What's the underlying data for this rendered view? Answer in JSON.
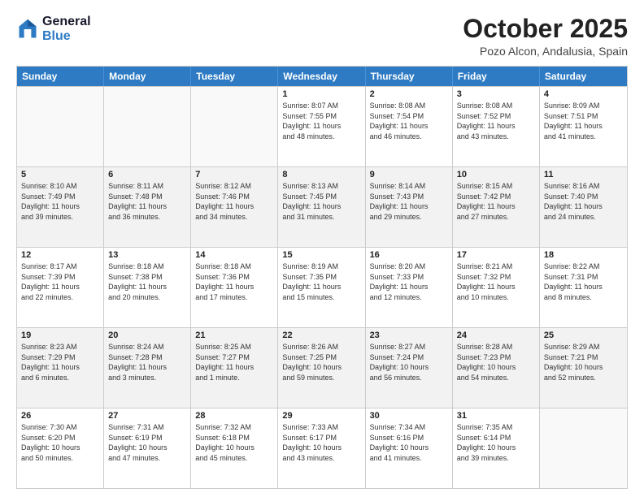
{
  "logo": {
    "line1": "General",
    "line2": "Blue"
  },
  "title": "October 2025",
  "location": "Pozo Alcon, Andalusia, Spain",
  "days_of_week": [
    "Sunday",
    "Monday",
    "Tuesday",
    "Wednesday",
    "Thursday",
    "Friday",
    "Saturday"
  ],
  "weeks": [
    [
      {
        "day": "",
        "info": ""
      },
      {
        "day": "",
        "info": ""
      },
      {
        "day": "",
        "info": ""
      },
      {
        "day": "1",
        "info": "Sunrise: 8:07 AM\nSunset: 7:55 PM\nDaylight: 11 hours\nand 48 minutes."
      },
      {
        "day": "2",
        "info": "Sunrise: 8:08 AM\nSunset: 7:54 PM\nDaylight: 11 hours\nand 46 minutes."
      },
      {
        "day": "3",
        "info": "Sunrise: 8:08 AM\nSunset: 7:52 PM\nDaylight: 11 hours\nand 43 minutes."
      },
      {
        "day": "4",
        "info": "Sunrise: 8:09 AM\nSunset: 7:51 PM\nDaylight: 11 hours\nand 41 minutes."
      }
    ],
    [
      {
        "day": "5",
        "info": "Sunrise: 8:10 AM\nSunset: 7:49 PM\nDaylight: 11 hours\nand 39 minutes."
      },
      {
        "day": "6",
        "info": "Sunrise: 8:11 AM\nSunset: 7:48 PM\nDaylight: 11 hours\nand 36 minutes."
      },
      {
        "day": "7",
        "info": "Sunrise: 8:12 AM\nSunset: 7:46 PM\nDaylight: 11 hours\nand 34 minutes."
      },
      {
        "day": "8",
        "info": "Sunrise: 8:13 AM\nSunset: 7:45 PM\nDaylight: 11 hours\nand 31 minutes."
      },
      {
        "day": "9",
        "info": "Sunrise: 8:14 AM\nSunset: 7:43 PM\nDaylight: 11 hours\nand 29 minutes."
      },
      {
        "day": "10",
        "info": "Sunrise: 8:15 AM\nSunset: 7:42 PM\nDaylight: 11 hours\nand 27 minutes."
      },
      {
        "day": "11",
        "info": "Sunrise: 8:16 AM\nSunset: 7:40 PM\nDaylight: 11 hours\nand 24 minutes."
      }
    ],
    [
      {
        "day": "12",
        "info": "Sunrise: 8:17 AM\nSunset: 7:39 PM\nDaylight: 11 hours\nand 22 minutes."
      },
      {
        "day": "13",
        "info": "Sunrise: 8:18 AM\nSunset: 7:38 PM\nDaylight: 11 hours\nand 20 minutes."
      },
      {
        "day": "14",
        "info": "Sunrise: 8:18 AM\nSunset: 7:36 PM\nDaylight: 11 hours\nand 17 minutes."
      },
      {
        "day": "15",
        "info": "Sunrise: 8:19 AM\nSunset: 7:35 PM\nDaylight: 11 hours\nand 15 minutes."
      },
      {
        "day": "16",
        "info": "Sunrise: 8:20 AM\nSunset: 7:33 PM\nDaylight: 11 hours\nand 12 minutes."
      },
      {
        "day": "17",
        "info": "Sunrise: 8:21 AM\nSunset: 7:32 PM\nDaylight: 11 hours\nand 10 minutes."
      },
      {
        "day": "18",
        "info": "Sunrise: 8:22 AM\nSunset: 7:31 PM\nDaylight: 11 hours\nand 8 minutes."
      }
    ],
    [
      {
        "day": "19",
        "info": "Sunrise: 8:23 AM\nSunset: 7:29 PM\nDaylight: 11 hours\nand 6 minutes."
      },
      {
        "day": "20",
        "info": "Sunrise: 8:24 AM\nSunset: 7:28 PM\nDaylight: 11 hours\nand 3 minutes."
      },
      {
        "day": "21",
        "info": "Sunrise: 8:25 AM\nSunset: 7:27 PM\nDaylight: 11 hours\nand 1 minute."
      },
      {
        "day": "22",
        "info": "Sunrise: 8:26 AM\nSunset: 7:25 PM\nDaylight: 10 hours\nand 59 minutes."
      },
      {
        "day": "23",
        "info": "Sunrise: 8:27 AM\nSunset: 7:24 PM\nDaylight: 10 hours\nand 56 minutes."
      },
      {
        "day": "24",
        "info": "Sunrise: 8:28 AM\nSunset: 7:23 PM\nDaylight: 10 hours\nand 54 minutes."
      },
      {
        "day": "25",
        "info": "Sunrise: 8:29 AM\nSunset: 7:21 PM\nDaylight: 10 hours\nand 52 minutes."
      }
    ],
    [
      {
        "day": "26",
        "info": "Sunrise: 7:30 AM\nSunset: 6:20 PM\nDaylight: 10 hours\nand 50 minutes."
      },
      {
        "day": "27",
        "info": "Sunrise: 7:31 AM\nSunset: 6:19 PM\nDaylight: 10 hours\nand 47 minutes."
      },
      {
        "day": "28",
        "info": "Sunrise: 7:32 AM\nSunset: 6:18 PM\nDaylight: 10 hours\nand 45 minutes."
      },
      {
        "day": "29",
        "info": "Sunrise: 7:33 AM\nSunset: 6:17 PM\nDaylight: 10 hours\nand 43 minutes."
      },
      {
        "day": "30",
        "info": "Sunrise: 7:34 AM\nSunset: 6:16 PM\nDaylight: 10 hours\nand 41 minutes."
      },
      {
        "day": "31",
        "info": "Sunrise: 7:35 AM\nSunset: 6:14 PM\nDaylight: 10 hours\nand 39 minutes."
      },
      {
        "day": "",
        "info": ""
      }
    ]
  ]
}
